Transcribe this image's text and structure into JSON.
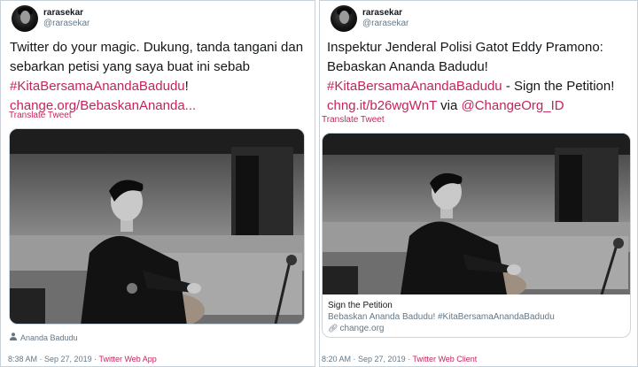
{
  "tweets": [
    {
      "author": {
        "name": "rarasekar",
        "handle": "@rarasekar"
      },
      "lines": [
        [
          {
            "t": "Twitter do your magic. Dukung, tanda tangani dan",
            "link": false
          }
        ],
        [
          {
            "t": "sebarkan petisi yang saya buat ini sebab",
            "link": false
          }
        ],
        [
          {
            "t": "#KitaBersamaAnandaBadudu",
            "link": true
          },
          {
            "t": "!",
            "link": false
          }
        ],
        [
          {
            "t": "change.org/BebaskanAnanda...",
            "link": true
          }
        ]
      ],
      "translate": "Translate Tweet",
      "tagged_person": "Ananda Badudu",
      "footer": {
        "time": "8:38 AM",
        "sep1": " · ",
        "date": "Sep 27, 2019",
        "sep2": " · ",
        "source": "Twitter Web App"
      }
    },
    {
      "author": {
        "name": "rarasekar",
        "handle": "@rarasekar"
      },
      "lines": [
        [
          {
            "t": "Inspektur Jenderal Polisi Gatot Eddy Pramono:",
            "link": false
          }
        ],
        [
          {
            "t": "Bebaskan Ananda Badudu!",
            "link": false
          }
        ],
        [
          {
            "t": "#KitaBersamaAnandaBadudu",
            "link": true
          },
          {
            "t": " - Sign the Petition!",
            "link": false
          }
        ],
        [
          {
            "t": "chng.it/b26wgWnT",
            "link": true
          },
          {
            "t": " via ",
            "link": false
          },
          {
            "t": "@ChangeOrg_ID",
            "link": true
          }
        ]
      ],
      "translate": "Translate Tweet",
      "card": {
        "title": "Sign the Petition",
        "description": "Bebaskan Ananda Badudu! #KitaBersamaAnandaBadudu",
        "site": "change.org"
      },
      "footer": {
        "time": "8:20 AM",
        "sep1": " · ",
        "date": "Sep 27, 2019",
        "sep2": " · ",
        "source": "Twitter Web Client"
      }
    }
  ],
  "colors": {
    "link": "#c4245e",
    "muted": "#657786",
    "text": "#14171a",
    "border": "#ccd6dd"
  },
  "icons": {
    "tag": "person-icon",
    "card_link": "link-icon"
  }
}
